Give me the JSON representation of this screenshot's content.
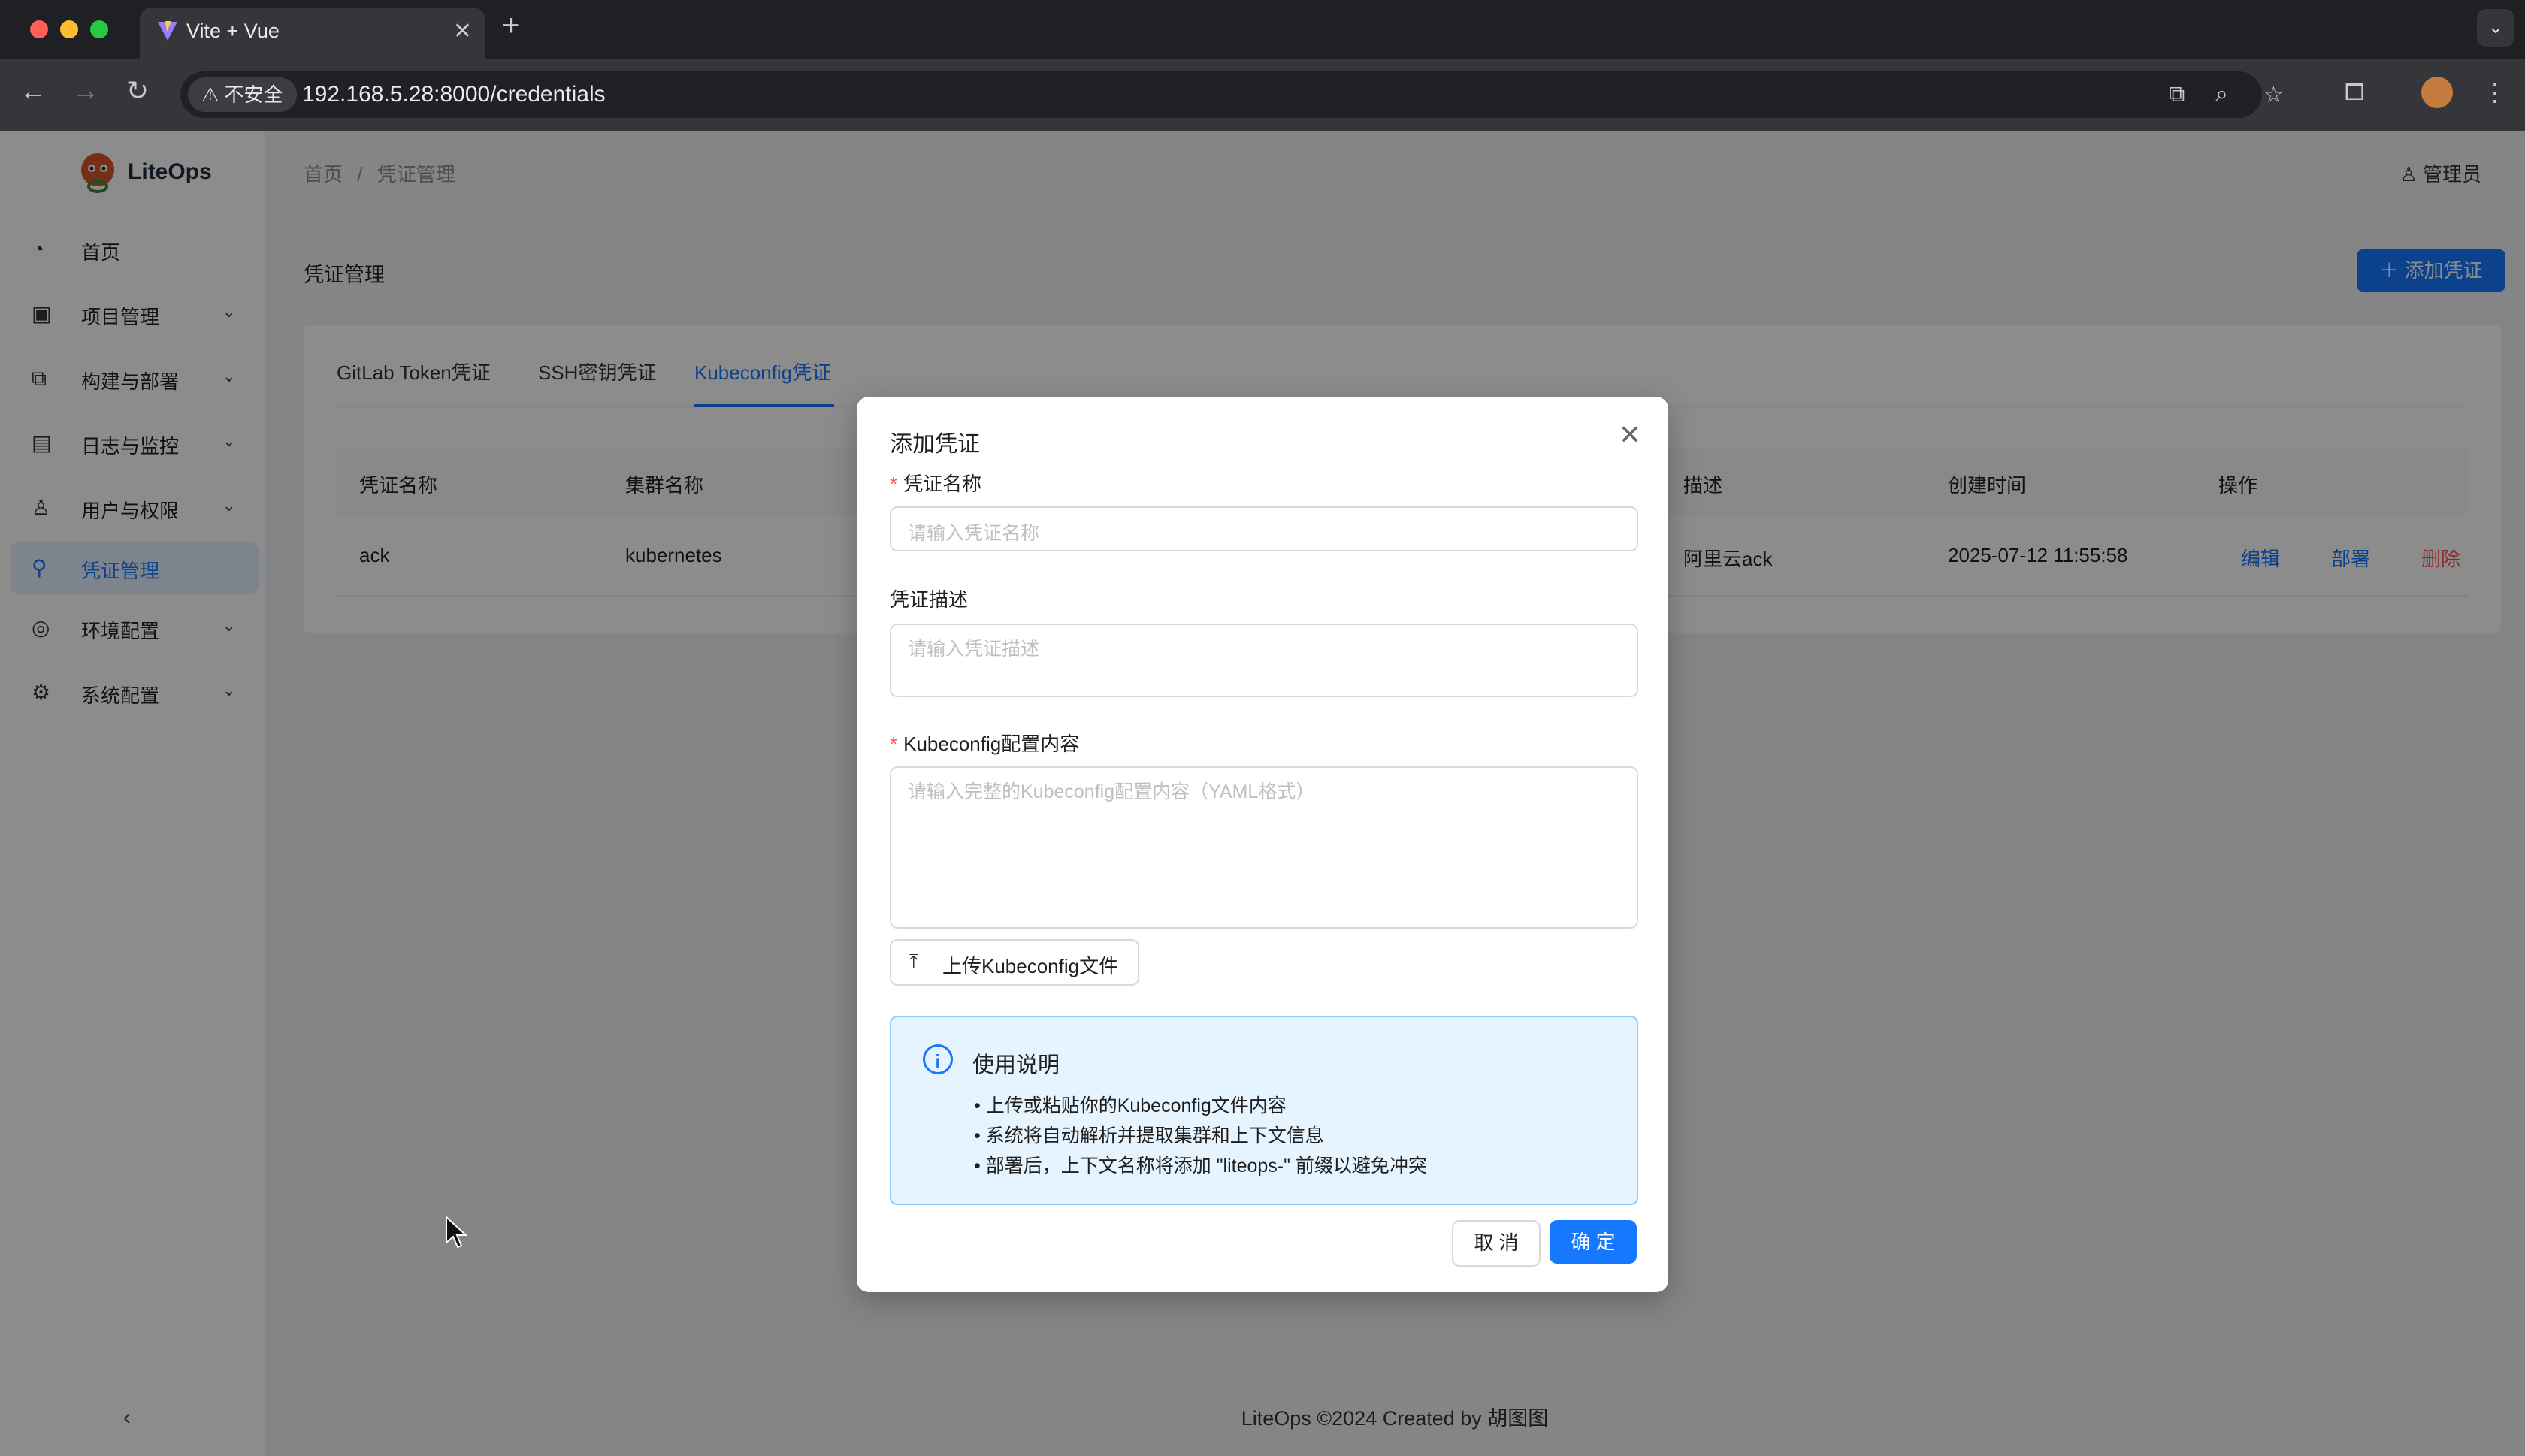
{
  "browser": {
    "tab_title": "Vite + Vue",
    "security_label": "不安全",
    "url": "192.168.5.28:8000/credentials"
  },
  "app": {
    "logo_text": "LiteOps",
    "sidebar": {
      "items": [
        {
          "label": "首页",
          "icon": "dashboard-icon"
        },
        {
          "label": "项目管理",
          "icon": "project-icon"
        },
        {
          "label": "构建与部署",
          "icon": "build-icon"
        },
        {
          "label": "日志与监控",
          "icon": "log-icon"
        },
        {
          "label": "用户与权限",
          "icon": "user-icon"
        },
        {
          "label": "凭证管理",
          "icon": "key-icon",
          "active": true
        },
        {
          "label": "环境配置",
          "icon": "environment-icon"
        },
        {
          "label": "系统配置",
          "icon": "settings-icon"
        }
      ]
    },
    "breadcrumb": {
      "home": "首页",
      "sep": "/",
      "current": "凭证管理"
    },
    "user_label": "管理员",
    "page_title": "凭证管理",
    "add_button": "添加凭证",
    "tabs": [
      "GitLab Token凭证",
      "SSH密钥凭证",
      "Kubeconfig凭证"
    ],
    "table": {
      "headers": [
        "凭证名称",
        "集群名称",
        "描述",
        "创建时间",
        "操作"
      ],
      "rows": [
        {
          "name": "ack",
          "cluster": "kubernetes",
          "desc": "阿里云ack",
          "created": "2025-07-12 11:55:58",
          "actions": [
            "编辑",
            "部署",
            "删除"
          ]
        }
      ]
    },
    "footer": "LiteOps ©2024 Created by 胡图图"
  },
  "modal": {
    "title": "添加凭证",
    "name_label": "凭证名称",
    "name_placeholder": "请输入凭证名称",
    "desc_label": "凭证描述",
    "desc_placeholder": "请输入凭证描述",
    "kube_label": "Kubeconfig配置内容",
    "kube_placeholder": "请输入完整的Kubeconfig配置内容（YAML格式）",
    "upload_label": "上传Kubeconfig文件",
    "info": {
      "title": "使用说明",
      "items": [
        "• 上传或粘贴你的Kubeconfig文件内容",
        "• 系统将自动解析并提取集群和上下文信息",
        "• 部署后，上下文名称将添加 \"liteops-\" 前缀以避免冲突"
      ]
    },
    "cancel": "取 消",
    "ok": "确 定"
  },
  "colors": {
    "primary": "#1677ff",
    "danger": "#ff4d4f"
  }
}
